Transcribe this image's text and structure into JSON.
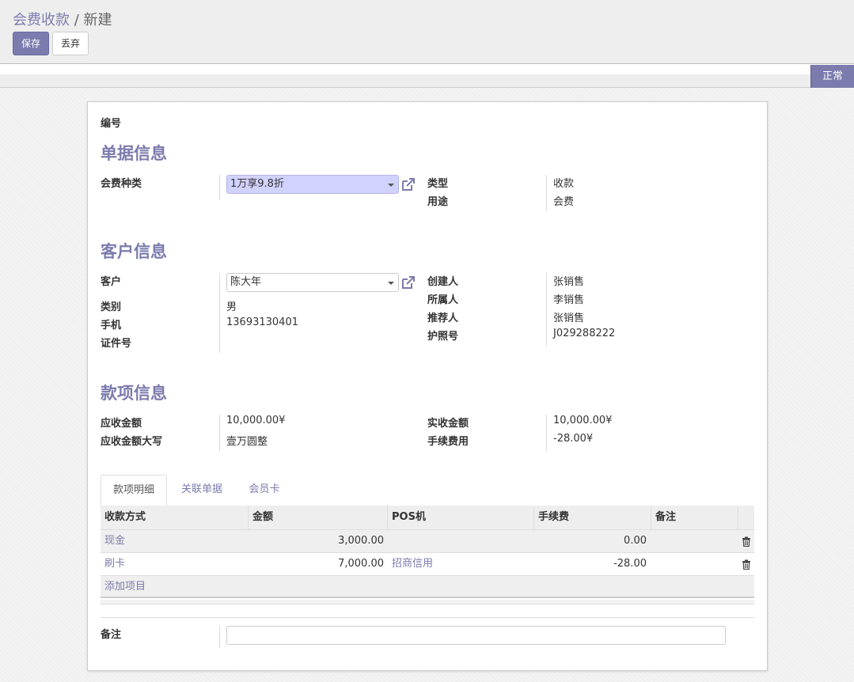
{
  "breadcrumb": {
    "parent": "会费收款",
    "separator": "/",
    "current": "新建"
  },
  "buttons": {
    "save": "保存",
    "discard": "丢弃"
  },
  "status": "正常",
  "form": {
    "number_label": "编号",
    "sections": {
      "bill": "单据信息",
      "customer": "客户信息",
      "payment": "款项信息"
    },
    "bill": {
      "fee_type_label": "会费种类",
      "fee_type_value": "1万享9.8折",
      "type_label": "类型",
      "type_value": "收款",
      "purpose_label": "用途",
      "purpose_value": "会费"
    },
    "customer": {
      "customer_label": "客户",
      "customer_value": "陈大年",
      "category_label": "类别",
      "category_value": "男",
      "phone_label": "手机",
      "phone_value": "13693130401",
      "id_label": "证件号",
      "creator_label": "创建人",
      "creator_value": "张销售",
      "owner_label": "所属人",
      "owner_value": "李销售",
      "referrer_label": "推荐人",
      "referrer_value": "张销售",
      "passport_label": "护照号",
      "passport_value": "J029288222"
    },
    "payment": {
      "receivable_label": "应收金额",
      "receivable_value": "10,000.00¥",
      "receivable_upper_label": "应收金额大写",
      "receivable_upper_value": "壹万圆整",
      "received_label": "实收金额",
      "received_value": "10,000.00¥",
      "fee_label": "手续费用",
      "fee_value": "-28.00¥"
    },
    "tabs": [
      "款项明细",
      "关联单据",
      "会员卡"
    ],
    "table": {
      "headers": [
        "收款方式",
        "金额",
        "POS机",
        "手续费",
        "备注"
      ],
      "rows": [
        {
          "method": "现金",
          "amount": "3,000.00",
          "pos": "",
          "fee": "0.00",
          "note": ""
        },
        {
          "method": "刷卡",
          "amount": "7,000.00",
          "pos": "招商信用",
          "fee": "-28.00",
          "note": ""
        }
      ],
      "add_item": "添加项目"
    },
    "note_label": "备注"
  },
  "colors": {
    "accent": "#7c7bad",
    "highlight_select": "#d2d2ff"
  },
  "icons": {
    "external_link": "external-link-icon",
    "trash": "trash-icon",
    "dropdown": "caret-down-icon"
  }
}
